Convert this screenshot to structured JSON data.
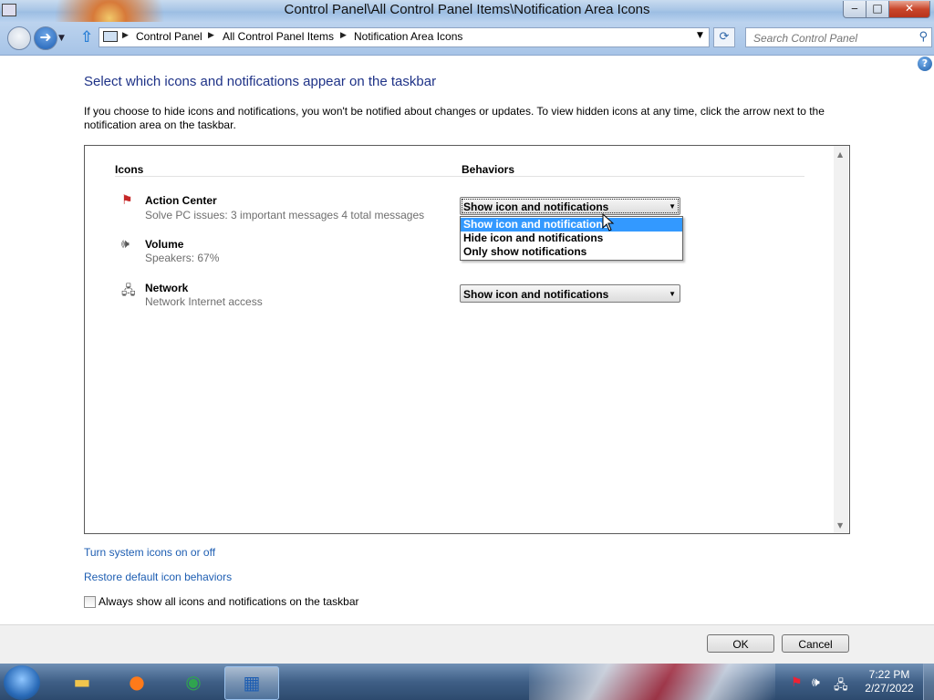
{
  "window": {
    "title": "Control Panel\\All Control Panel Items\\Notification Area Icons",
    "controls": {
      "minimize": "‒",
      "maximize": "□",
      "close": "✕"
    }
  },
  "address_bar": {
    "breadcrumbs": [
      "Control Panel",
      "All Control Panel Items",
      "Notification Area Icons"
    ],
    "search_placeholder": "Search Control Panel"
  },
  "page": {
    "title": "Select which icons and notifications appear on the taskbar",
    "intro": "If you choose to hide icons and notifications, you won't be notified about changes or updates. To view hidden icons at any time, click the arrow next to the notification area on the taskbar.",
    "columns": {
      "icons": "Icons",
      "behaviors": "Behaviors"
    },
    "items": [
      {
        "name": "Action Center",
        "desc": "Solve PC issues: 3 important messages  4 total messages",
        "icon": "action-center-flag-icon",
        "behavior": "Show icon and notifications"
      },
      {
        "name": "Volume",
        "desc": "Speakers: 67%",
        "icon": "speaker-icon",
        "behavior": ""
      },
      {
        "name": "Network",
        "desc": "Network  Internet access",
        "icon": "network-icon",
        "behavior": "Show icon and notifications"
      }
    ],
    "dropdown": {
      "options": [
        "Show icon and notifications",
        "Hide icon and notifications",
        "Only show notifications"
      ],
      "highlighted": "Show icon and notifications"
    },
    "links": {
      "system_icons": "Turn system icons on or off",
      "restore": "Restore default icon behaviors"
    },
    "checkbox": {
      "label": "Always show all icons and notifications on the taskbar",
      "checked": false
    }
  },
  "buttons": {
    "ok": "OK",
    "cancel": "Cancel"
  },
  "taskbar": {
    "apps": [
      "windows-explorer",
      "firefox",
      "chrome",
      "control-panel"
    ],
    "clock_time": "7:22 PM",
    "clock_date": "2/27/2022"
  },
  "colors": {
    "highlight": "#3399ff",
    "link": "#1e5eb2",
    "title": "#1e3287"
  }
}
